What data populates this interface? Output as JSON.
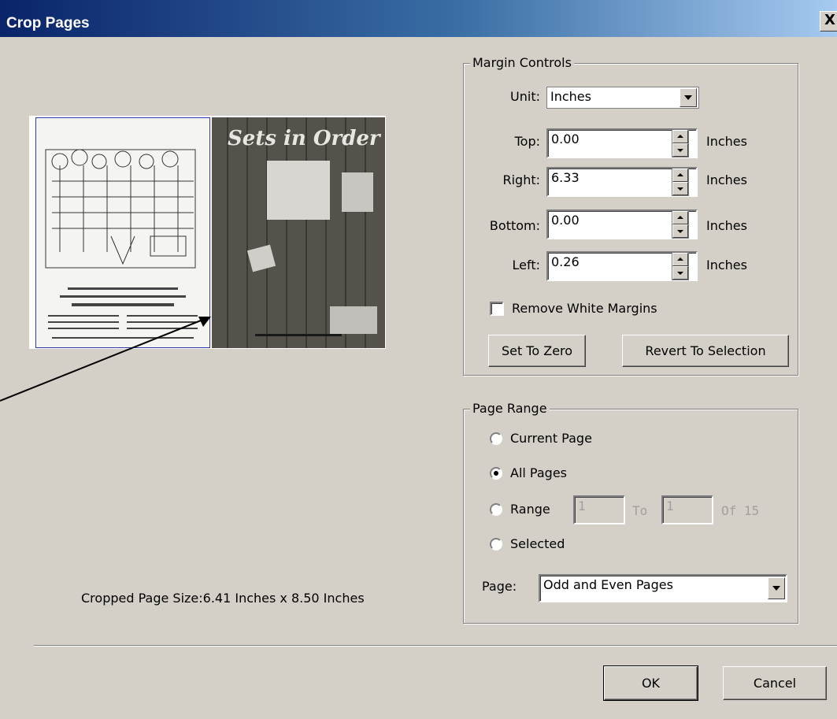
{
  "window": {
    "title": "Crop Pages",
    "close_label": "X"
  },
  "preview": {
    "magazine_title": "Sets in Order"
  },
  "cropped_size": "Cropped Page Size:6.41 Inches x 8.50 Inches",
  "margin_controls": {
    "legend": "Margin Controls",
    "unit_label": "Unit:",
    "unit_value": "Inches",
    "fields": [
      {
        "label": "Top:",
        "value": "0.00",
        "unit": "Inches"
      },
      {
        "label": "Right:",
        "value": "6.33",
        "unit": "Inches"
      },
      {
        "label": "Bottom:",
        "value": "0.00",
        "unit": "Inches"
      },
      {
        "label": "Left:",
        "value": "0.26",
        "unit": "Inches"
      }
    ],
    "remove_white_margins": "Remove White Margins",
    "remove_white_margins_checked": false,
    "set_to_zero": "Set To Zero",
    "revert_to_selection": "Revert To Selection"
  },
  "page_range": {
    "legend": "Page Range",
    "current_page": "Current Page",
    "all_pages": "All Pages",
    "range": "Range",
    "range_from": "1",
    "to_label": "To",
    "range_to": "1",
    "of_label": "Of 15",
    "selected": "Selected",
    "page_label": "Page:",
    "page_value": "Odd and Even Pages",
    "checked": "all_pages"
  },
  "buttons": {
    "ok": "OK",
    "cancel": "Cancel"
  },
  "colors": {
    "title_gradient_start": "#0a246a",
    "title_gradient_end": "#a6caf0",
    "dialog_bg": "#d4d0c8"
  }
}
